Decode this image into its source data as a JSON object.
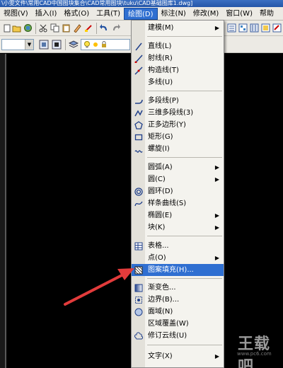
{
  "window": {
    "title": "\\小雯文件\\常用CAD中国图块集合\\CAD常用图块\\tuku\\CAD基础图库1.dwg]"
  },
  "menubar": {
    "items": [
      {
        "label": "视图(V)"
      },
      {
        "label": "插入(I)"
      },
      {
        "label": "格式(O)"
      },
      {
        "label": "工具(T)"
      },
      {
        "label": "绘图(D)"
      },
      {
        "label": "标注(N)"
      },
      {
        "label": "修改(M)"
      },
      {
        "label": "窗口(W)"
      },
      {
        "label": "帮助"
      }
    ],
    "active_index": 4
  },
  "draw_menu": {
    "items": [
      {
        "label": "建模(M)",
        "icon": "none",
        "submenu": true
      },
      {
        "label": "直线(L)",
        "icon": "line-icon"
      },
      {
        "label": "射线(R)",
        "icon": "ray-icon"
      },
      {
        "label": "构造线(T)",
        "icon": "construction-line-icon"
      },
      {
        "label": "多线(U)",
        "icon": "none"
      },
      {
        "label": "多段线(P)",
        "icon": "polyline-icon"
      },
      {
        "label": "三维多段线(3)",
        "icon": "3d-polyline-icon"
      },
      {
        "label": "正多边形(Y)",
        "icon": "polygon-icon"
      },
      {
        "label": "矩形(G)",
        "icon": "rectangle-icon"
      },
      {
        "label": "螺旋(I)",
        "icon": "helix-icon"
      },
      {
        "label": "圆弧(A)",
        "icon": "none",
        "submenu": true
      },
      {
        "label": "圆(C)",
        "icon": "none",
        "submenu": true
      },
      {
        "label": "圆环(D)",
        "icon": "donut-icon"
      },
      {
        "label": "样条曲线(S)",
        "icon": "spline-icon"
      },
      {
        "label": "椭圆(E)",
        "icon": "none",
        "submenu": true
      },
      {
        "label": "块(K)",
        "icon": "none",
        "submenu": true
      },
      {
        "label": "表格...",
        "icon": "table-icon"
      },
      {
        "label": "点(O)",
        "icon": "none",
        "submenu": true
      },
      {
        "label": "图案填充(H)...",
        "icon": "hatch-icon",
        "highlighted": true
      },
      {
        "label": "渐变色...",
        "icon": "gradient-icon"
      },
      {
        "label": "边界(B)...",
        "icon": "boundary-icon"
      },
      {
        "label": "面域(N)",
        "icon": "region-icon"
      },
      {
        "label": "区域覆盖(W)",
        "icon": "none"
      },
      {
        "label": "修订云线(U)",
        "icon": "revcloud-icon"
      },
      {
        "label": "文字(X)",
        "icon": "none",
        "submenu": true
      }
    ],
    "submenu_arrow": "▶"
  },
  "watermark": {
    "text": "王载吧",
    "sub": "www.pc6.com"
  },
  "colors": {
    "highlight": "#2f6fd1",
    "menu_bg": "#f4f3ee",
    "toolbar_bg": "#eceae4",
    "canvas_bg": "#000000",
    "arrow": "#e23b3b"
  }
}
